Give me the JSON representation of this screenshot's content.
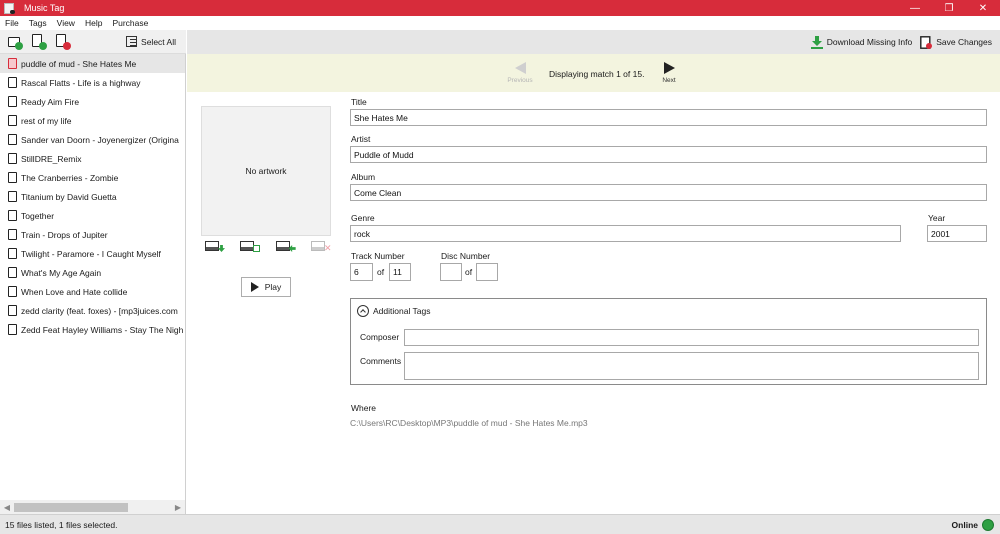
{
  "window": {
    "title": "Music Tag",
    "minimize": "—",
    "maximize": "❐",
    "close": "✕"
  },
  "menu": [
    "File",
    "Tags",
    "View",
    "Help",
    "Purchase"
  ],
  "left_toolbar": {
    "select_all": "Select All"
  },
  "right_toolbar": {
    "download": "Download Missing Info",
    "save": "Save Changes"
  },
  "files": [
    "puddle of mud - She Hates Me",
    "Rascal Flatts - Life is a highway",
    "Ready Aim Fire",
    "rest of my life",
    "Sander van Doorn - Joyenergizer (Origina",
    "StillDRE_Remix",
    "The Cranberries - Zombie",
    "Titanium by David Guetta",
    "Together",
    "Train - Drops of Jupiter",
    "Twilight - Paramore - I Caught Myself",
    "What's My Age Again",
    "When Love and Hate collide",
    "zedd clarity (feat. foxes) - [mp3juices.com",
    "Zedd Feat Hayley Williams - Stay The Nigh"
  ],
  "match": {
    "previous": "Previous",
    "next": "Next",
    "text": "Displaying match 1 of 15."
  },
  "artwork": {
    "placeholder": "No artwork",
    "play": "Play"
  },
  "fields": {
    "title_label": "Title",
    "title": "She Hates Me",
    "artist_label": "Artist",
    "artist": "Puddle of Mudd",
    "album_label": "Album",
    "album": "Come Clean",
    "genre_label": "Genre",
    "genre": "rock",
    "year_label": "Year",
    "year": "2001",
    "track_label": "Track Number",
    "track": "6",
    "track_total": "11",
    "disc_label": "Disc Number",
    "disc": "",
    "disc_total": "",
    "of": "of"
  },
  "additional": {
    "header": "Additional Tags",
    "composer_label": "Composer",
    "composer": "",
    "comments_label": "Comments",
    "comments": ""
  },
  "where": {
    "label": "Where",
    "path": "C:\\Users\\RC\\Desktop\\MP3\\puddle of mud - She Hates Me.mp3"
  },
  "status": {
    "text": "15 files listed,  1 files selected.",
    "online": "Online"
  },
  "colors": {
    "accent": "#d72c3b",
    "match_bar": "#f3f4df",
    "online_globe": "#2ea043"
  }
}
